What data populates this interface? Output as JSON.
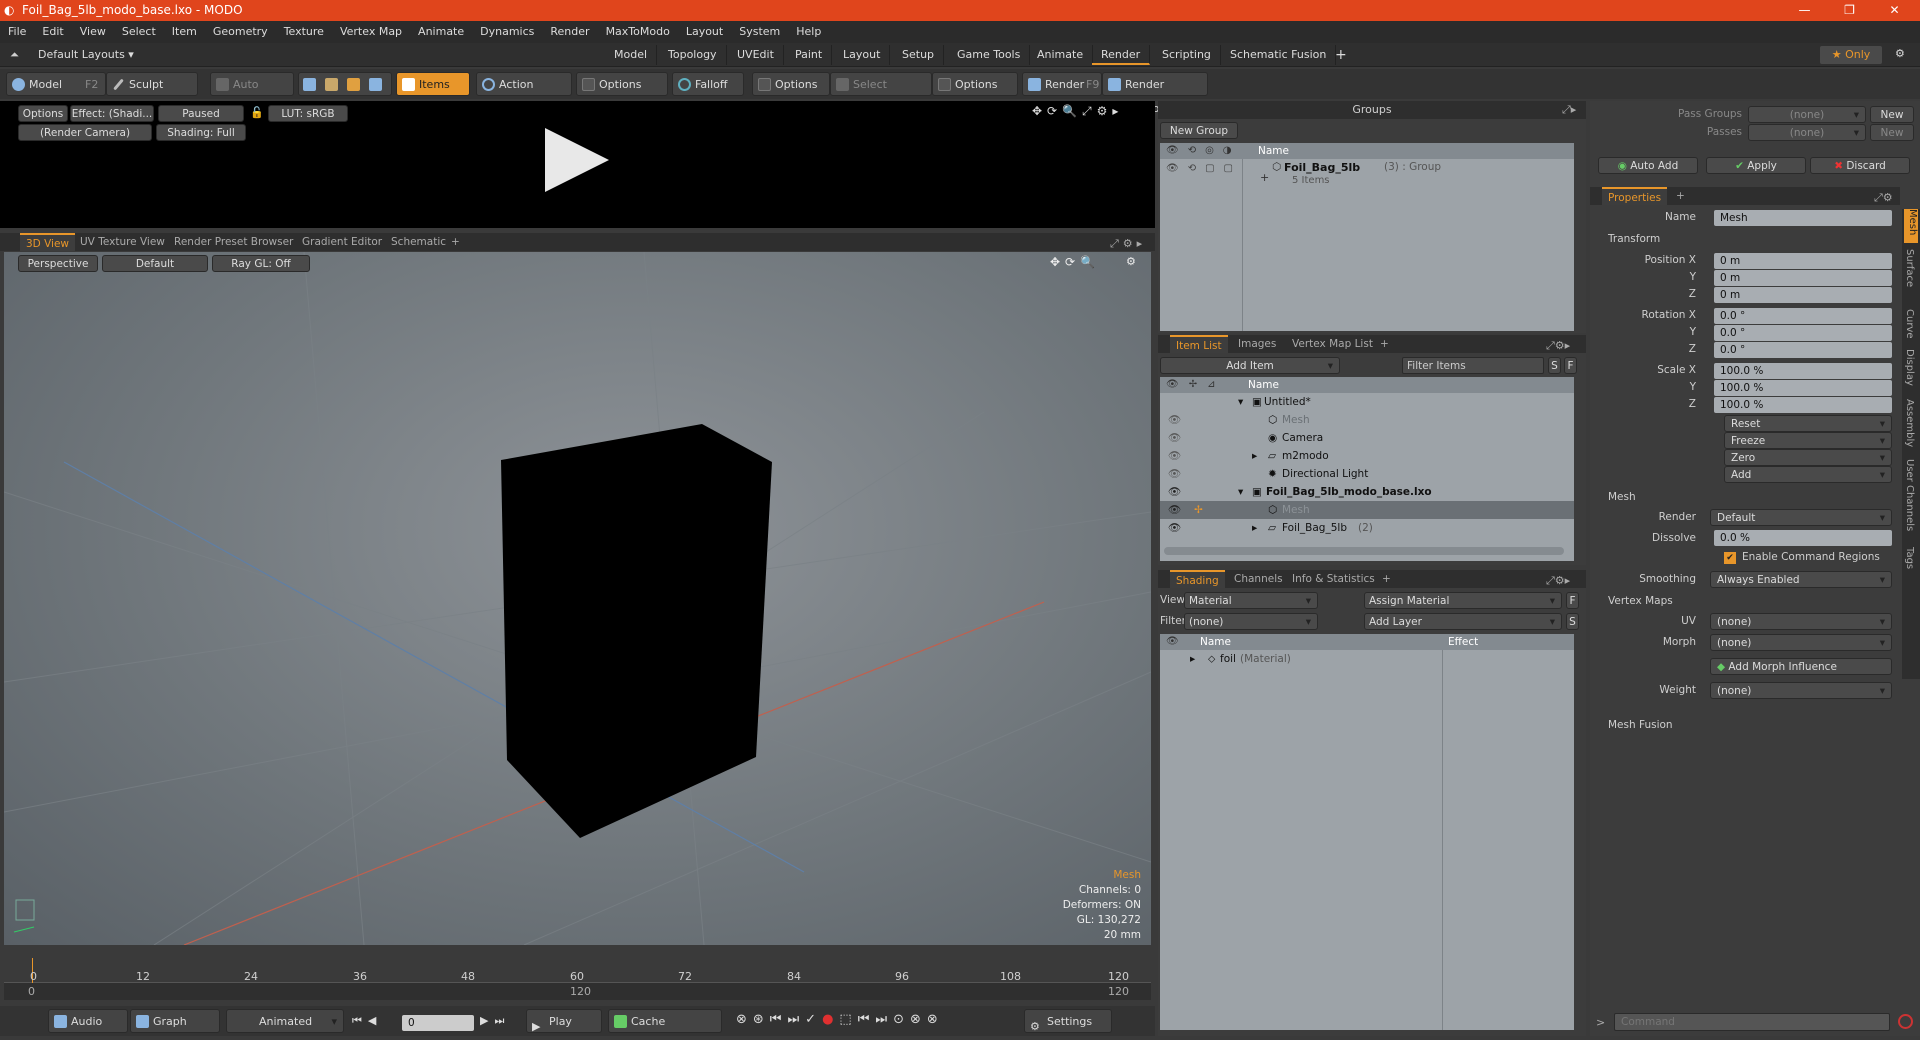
{
  "window": {
    "title": "Foil_Bag_5lb_modo_base.lxo - MODO",
    "minimize": "—",
    "maximize": "❐",
    "close": "✕"
  },
  "menu": [
    "File",
    "Edit",
    "View",
    "Select",
    "Item",
    "Geometry",
    "Texture",
    "Vertex Map",
    "Animate",
    "Dynamics",
    "Render",
    "MaxToModo",
    "Layout",
    "System",
    "Help"
  ],
  "layoutbar": {
    "layouts": "Default Layouts ▾",
    "tabs": [
      "Model",
      "Topology",
      "UVEdit",
      "Paint",
      "Layout",
      "Setup",
      "Game Tools",
      "Animate",
      "Render",
      "Scripting",
      "Schematic Fusion"
    ],
    "active": "Render",
    "plus": "+",
    "only": "★ Only",
    "gear": "⚙"
  },
  "toolbar": {
    "model": "Model",
    "model_key": "F2",
    "sculpt": "Sculpt",
    "auto_select": "Auto Select",
    "items": "Items",
    "action_center": "Action Center",
    "options1": "Options",
    "falloff": "Falloff",
    "options2": "Options",
    "select_through": "Select Through",
    "options3": "Options",
    "render": "Render",
    "render_key": "F9",
    "render_window": "Render Window"
  },
  "preview": {
    "options": "Options",
    "effect": "Effect: (Shadi...",
    "paused": "Paused",
    "lut": "LUT: sRGB",
    "camera": "(Render Camera)",
    "shading": "Shading: Full"
  },
  "viewtabs": {
    "tabs": [
      "3D View",
      "UV Texture View",
      "Render Preset Browser",
      "Gradient Editor",
      "Schematic"
    ],
    "active": "3D View",
    "plus": "+"
  },
  "viewport": {
    "perspective": "Perspective",
    "default": "Default",
    "raygl": "Ray GL: Off",
    "info": [
      "Mesh",
      "Channels: 0",
      "Deformers: ON",
      "GL: 130,272",
      "20 mm"
    ]
  },
  "timeline": {
    "ticks": [
      "0",
      "12",
      "24",
      "36",
      "48",
      "60",
      "72",
      "84",
      "96",
      "108",
      "120"
    ],
    "sub_ticks": [
      "0",
      "120",
      "120"
    ]
  },
  "bottombar": {
    "audio": "Audio",
    "graph_editor": "Graph Editor",
    "animated": "Animated",
    "frame": "0",
    "play": "Play",
    "cache": "Cache Deformers",
    "settings": "Settings"
  },
  "groups": {
    "title": "Groups",
    "new_group": "New Group",
    "col_name": "Name",
    "item_name": "Foil_Bag_5lb",
    "item_suffix": "(3) : Group",
    "item_sub": "5 Items"
  },
  "itemlist": {
    "tabs": [
      "Item List",
      "Images",
      "Vertex Map List"
    ],
    "active": "Item List",
    "plus": "+",
    "add_item": "Add Item",
    "filter": "Filter Items",
    "s": "S",
    "f": "F",
    "col_name": "Name",
    "rows": [
      {
        "label": "Untitled*",
        "bold": false,
        "indent": 0
      },
      {
        "label": "Mesh",
        "bold": false,
        "indent": 1,
        "dim": true
      },
      {
        "label": "Camera",
        "bold": false,
        "indent": 1
      },
      {
        "label": "m2modo",
        "bold": false,
        "indent": 1
      },
      {
        "label": "Directional Light",
        "bold": false,
        "indent": 1
      },
      {
        "label": "Foil_Bag_5lb_modo_base.lxo",
        "bold": true,
        "indent": 0
      },
      {
        "label": "Mesh",
        "bold": false,
        "indent": 1,
        "dim": true,
        "selected": true
      },
      {
        "label": "Foil_Bag_5lb",
        "bold": false,
        "indent": 1,
        "suffix": "(2)"
      }
    ]
  },
  "shading": {
    "tabs": [
      "Shading",
      "Channels",
      "Info & Statistics"
    ],
    "active": "Shading",
    "plus": "+",
    "view_label": "View",
    "view_value": "Material",
    "assign": "Assign Material",
    "f": "F",
    "filter_label": "Filter",
    "filter_value": "(none)",
    "add_layer": "Add Layer",
    "s": "S",
    "col_name": "Name",
    "col_effect": "Effect",
    "row": "foil",
    "row_suffix": "(Material)"
  },
  "props": {
    "pass_groups": "Pass Groups",
    "passes": "Passes",
    "none": "(none)",
    "new": "New",
    "auto_add": "Auto Add",
    "apply": "Apply",
    "discard": "Discard",
    "tab": "Properties",
    "plus": "+",
    "name_label": "Name",
    "name_value": "Mesh",
    "transform": "Transform",
    "pos_x": "Position X",
    "y": "Y",
    "z": "Z",
    "rot_x": "Rotation X",
    "scale_x": "Scale X",
    "zero_m": "0 m",
    "zero_deg": "0.0 °",
    "hundred": "100.0 %",
    "reset": "Reset",
    "freeze": "Freeze",
    "zero": "Zero",
    "add": "Add",
    "mesh": "Mesh",
    "render_label": "Render",
    "render_value": "Default",
    "dissolve_label": "Dissolve",
    "dissolve_value": "0.0 %",
    "enable_cmd": "Enable Command Regions",
    "smoothing_label": "Smoothing",
    "smoothing_value": "Always Enabled",
    "vertex_maps": "Vertex Maps",
    "uv_label": "UV",
    "morph_label": "Morph",
    "add_morph": "Add Morph Influence",
    "weight_label": "Weight",
    "mesh_fusion": "Mesh Fusion",
    "side_tabs": [
      "Mesh",
      "Surface",
      "Curve",
      "Display",
      "Assembly",
      "User Channels",
      "Tags"
    ]
  },
  "command": {
    "placeholder": "Command"
  }
}
